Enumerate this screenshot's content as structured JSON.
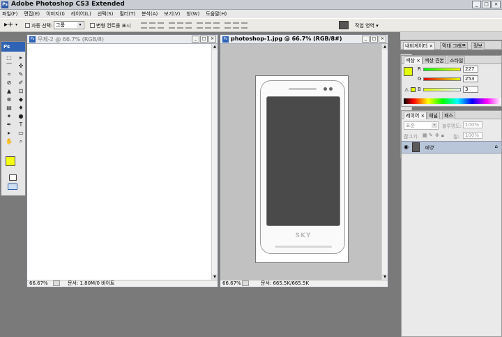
{
  "app": {
    "title": "Adobe Photoshop CS3 Extended",
    "ps_badge": "Ps"
  },
  "window_buttons": {
    "minimize": "_",
    "maximize": "□",
    "close": "×"
  },
  "menu": [
    "파일(F)",
    "편집(E)",
    "이미지(I)",
    "레이어(L)",
    "선택(S)",
    "필터(T)",
    "분석(A)",
    "보기(V)",
    "창(W)",
    "도움말(H)"
  ],
  "options_bar": {
    "tool_glyph": "▸+",
    "tool_arrow": "▾",
    "auto_select_label": "자동 선택:",
    "auto_select_value": "그룹",
    "transform_label": "변형 컨트롤 표시",
    "workspace_label": "작업 영역 ▾",
    "select_arrow": "▾"
  },
  "toolbox": {
    "header": "Ps",
    "tools": [
      "⬚",
      "▸",
      "⌒",
      "✜",
      "⌗",
      "✎",
      "⊘",
      "✐",
      "▲",
      "⊡",
      "⊗",
      "◆",
      "▤",
      "♦",
      "✦",
      "●",
      "✒",
      "T",
      "▸",
      "▭",
      "✋",
      "⌕",
      "⬚",
      "○"
    ],
    "fg_color": "#f4ff12",
    "bg_color": "#ffffff"
  },
  "doc1": {
    "title": "무제-2 @ 66.7% (RGB/8)",
    "zoom": "66.67%",
    "status": "문서: 1.80M/0 바이트",
    "icon": "Ps"
  },
  "doc2": {
    "title": "photoshop-1.jpg @ 66.7% (RGB/8#)",
    "zoom": "66.67%",
    "status": "문서: 665.5K/665.5K",
    "phone_brand": "SKY",
    "icon": "Ps"
  },
  "panels": {
    "nav_tabs": [
      "내비게이터 ×",
      "막대 그래프",
      "정보"
    ],
    "color_tabs": [
      "색상 ×",
      "색상 견본",
      "스타일"
    ],
    "color": {
      "r_label": "R",
      "r_value": "227",
      "g_label": "G",
      "g_value": "253",
      "b_label": "B",
      "b_value": "3",
      "current": "#e3fd03"
    },
    "layers_tabs": [
      "레이어 ×",
      "채널",
      "패스"
    ],
    "layers": {
      "blend_mode": "표준",
      "opacity_label": "불투명도:",
      "opacity_value": "100%",
      "lock_label": "잠그기:",
      "fill_label": "칠:",
      "fill_value": "100%",
      "row_name": "배경"
    }
  }
}
